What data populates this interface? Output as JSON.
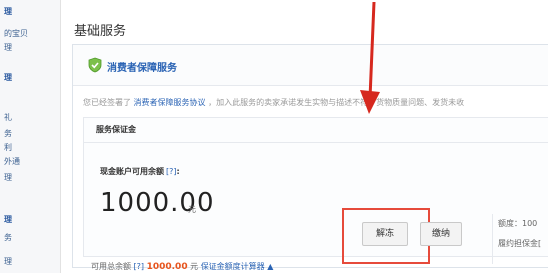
{
  "sidebar": {
    "items": [
      {
        "label": "理",
        "head": true
      },
      {
        "label": "的宝贝",
        "head": false
      },
      {
        "label": "理",
        "head": false
      },
      {
        "label": "理",
        "head": true
      },
      {
        "label": "礼",
        "head": false
      },
      {
        "label": "务",
        "head": false
      },
      {
        "label": "利",
        "head": false
      },
      {
        "label": "外通",
        "head": false
      },
      {
        "label": "理",
        "head": false
      },
      {
        "label": "理",
        "head": true
      },
      {
        "label": "务",
        "head": false
      },
      {
        "label": "理",
        "head": false
      }
    ]
  },
  "main": {
    "section_title": "基础服务",
    "panel": {
      "title": "消费者保障服务",
      "agree_prefix": "您已经签署了",
      "agree_link": "消费者保障服务协议",
      "agree_suffix": "，加入此服务的卖家承诺发生实物与描述不符、货物质量问题、发货未收",
      "card": {
        "title": "服务保证金",
        "available_label": "现金账户可用余额",
        "qmark": "[?]",
        "colon": ":",
        "amount": "1000.00",
        "amount_unit": "元",
        "unfreeze_label": "解冻",
        "pay_label": "缴纳",
        "quota_label": "额度：100",
        "bond_label": "履约担保金[",
        "total_label": "可用总余额",
        "total_qmark": "[?]",
        "total_value": "1000.00",
        "total_unit": "元",
        "calculator_label": "保证金额度计算器 ▲"
      }
    }
  },
  "colors": {
    "link": "#2a63b4",
    "highlight": "#e64a3b",
    "amount_orange": "#e8541c"
  }
}
